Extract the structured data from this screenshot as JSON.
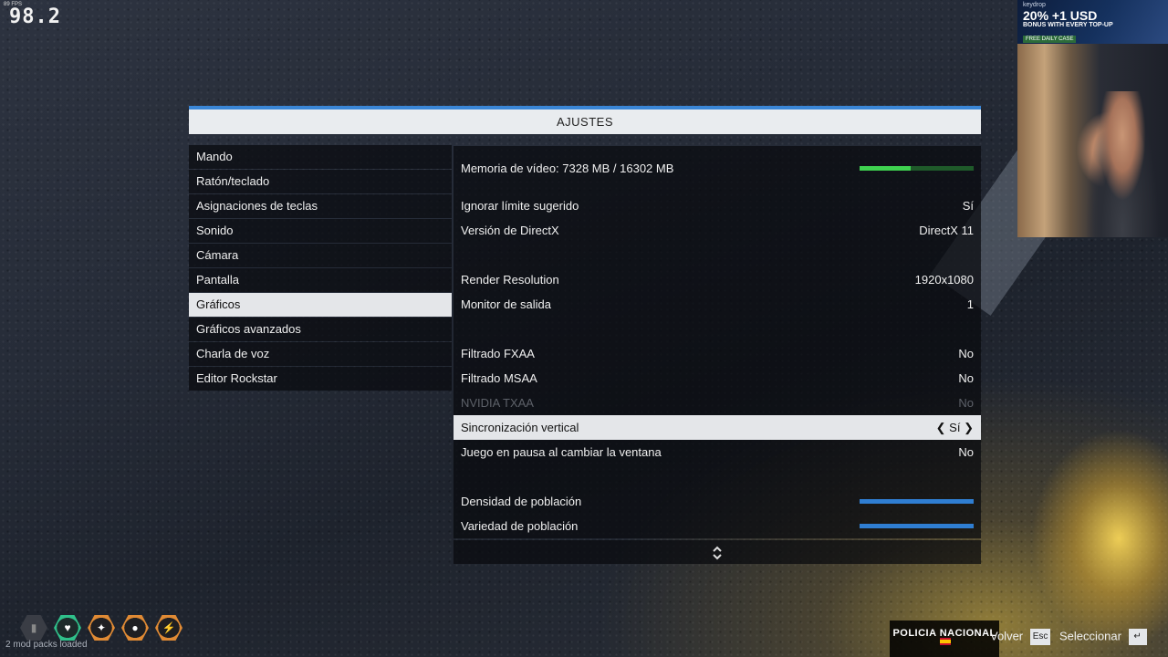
{
  "overlay": {
    "fps_small": "89 FPS",
    "fps_big": "98.2"
  },
  "window": {
    "title": "AJUSTES"
  },
  "menu": {
    "items": [
      {
        "label": "Mando"
      },
      {
        "label": "Ratón/teclado"
      },
      {
        "label": "Asignaciones de teclas"
      },
      {
        "label": "Sonido"
      },
      {
        "label": "Cámara"
      },
      {
        "label": "Pantalla"
      },
      {
        "label": "Gráficos",
        "selected": true
      },
      {
        "label": "Gráficos avanzados"
      },
      {
        "label": "Charla de voz"
      },
      {
        "label": "Editor Rockstar"
      }
    ]
  },
  "settings": {
    "video_memory": {
      "label": "Memoria de vídeo: 7328 MB / 16302 MB",
      "usage_fraction": 0.45
    },
    "ignore_limit": {
      "label": "Ignorar límite sugerido",
      "value": "Sí"
    },
    "directx": {
      "label": "Versión de DirectX",
      "value": "DirectX 11"
    },
    "render_resolution": {
      "label": "Render Resolution",
      "value": "1920x1080"
    },
    "output_monitor": {
      "label": "Monitor de salida",
      "value": "1"
    },
    "fxaa": {
      "label": "Filtrado FXAA",
      "value": "No"
    },
    "msaa": {
      "label": "Filtrado MSAA",
      "value": "No"
    },
    "txaa": {
      "label": "NVIDIA TXAA",
      "value": "No"
    },
    "vsync": {
      "label": "Sincronización vertical",
      "value": "Sí"
    },
    "pause_focus": {
      "label": "Juego en pausa al cambiar la ventana",
      "value": "No"
    },
    "pop_density": {
      "label": "Densidad de población",
      "level": 1.0
    },
    "pop_variety": {
      "label": "Variedad de población",
      "level": 1.0
    }
  },
  "ad": {
    "brand": "keydrop",
    "line1": "20% +1 USD",
    "line2": "BONUS WITH EVERY TOP-UP",
    "tag": "FREE DAILY CASE"
  },
  "hud": {
    "mod_text": "2 mod packs loaded"
  },
  "footer": {
    "logo": "POLICIA NACIONAL",
    "back_label": "Volver",
    "back_key": "Esc",
    "select_label": "Seleccionar",
    "select_key": "↵"
  },
  "colors": {
    "accent": "#3a86d6",
    "memory_bar": "#3fd250",
    "slider": "#2f7ed2"
  }
}
